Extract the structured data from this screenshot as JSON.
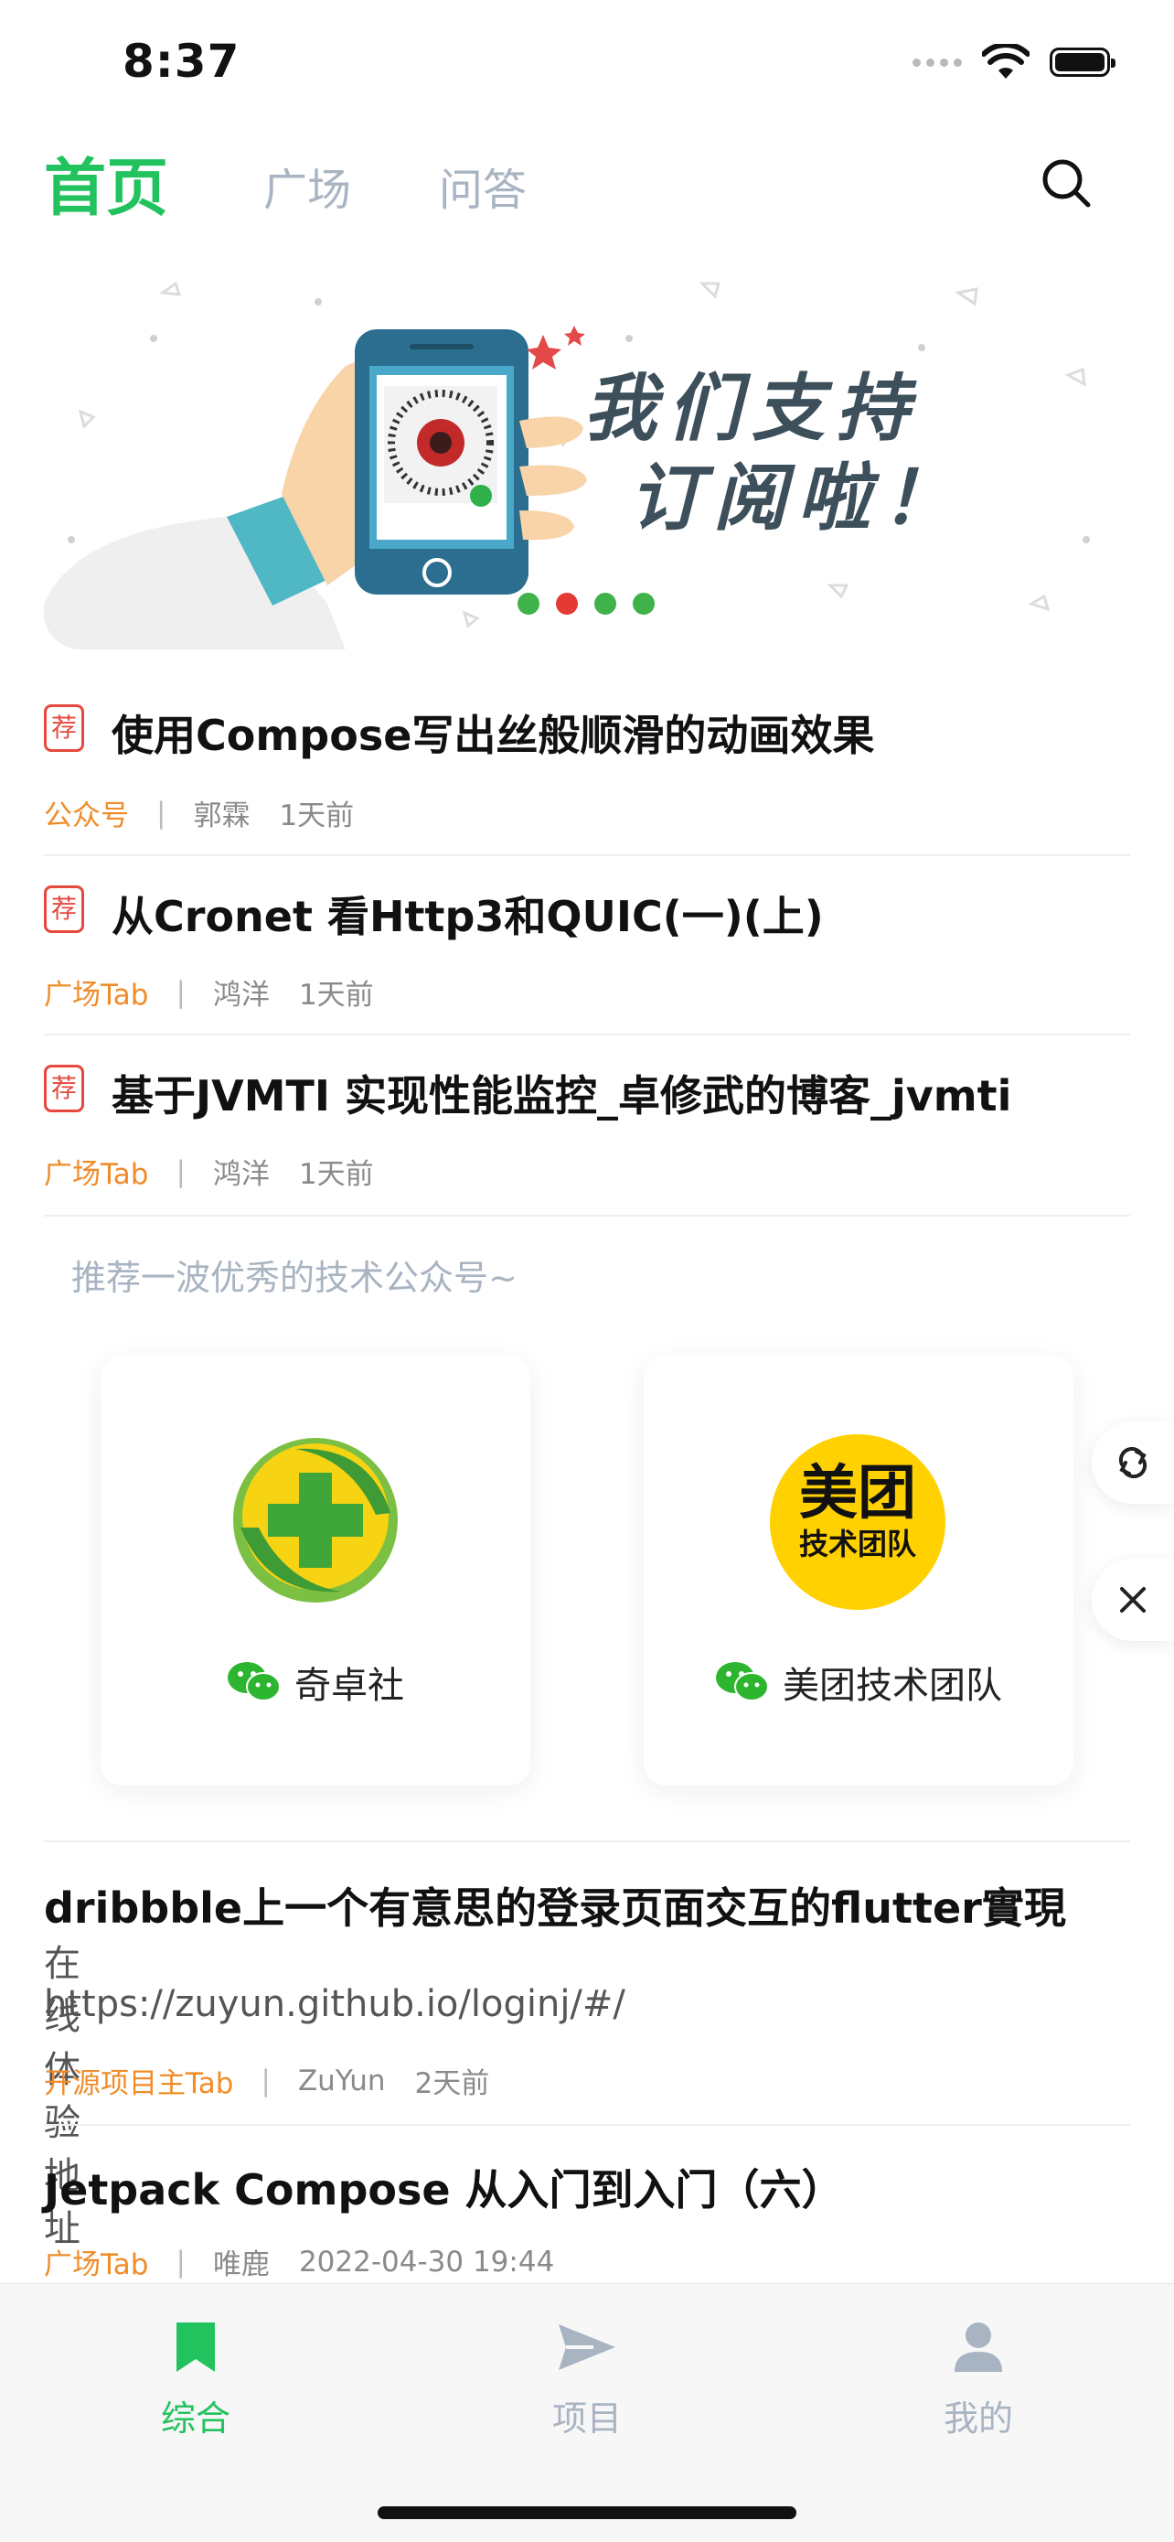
{
  "status_bar": {
    "time": "8:37"
  },
  "header": {
    "tabs": [
      {
        "label": "首页",
        "active": true
      },
      {
        "label": "广场",
        "active": false
      },
      {
        "label": "问答",
        "active": false
      }
    ],
    "icons": {
      "search": "search-icon"
    }
  },
  "banner": {
    "text_line1": "我们支持",
    "text_line2": "订阅啦！",
    "pager_colors": [
      "#3fb24a",
      "#e53935",
      "#3fb24a",
      "#3fb24a"
    ]
  },
  "articles": [
    {
      "tag": "荐",
      "title": "使用Compose写出丝般顺滑的动画效果",
      "chapter": "公众号",
      "sep": "|",
      "author": "郭霖",
      "time": "1天前"
    },
    {
      "tag": "荐",
      "title": "从Cronet 看Http3和QUIC(一)(上)",
      "chapter": "广场Tab",
      "sep": "|",
      "author": "鸿洋",
      "time": "1天前"
    },
    {
      "tag": "荐",
      "title": "基于JVMTI 实现性能监控_卓修武的博客_jvmti",
      "chapter": "广场Tab",
      "sep": "|",
      "author": "鸿洋",
      "time": "1天前"
    }
  ],
  "recommend": {
    "title": "推荐一波优秀的技术公众号~",
    "accounts": [
      {
        "name": "奇卓社",
        "logo": "qizhuo-logo"
      },
      {
        "name": "美团技术团队",
        "logo": "meituan-logo",
        "logo_text1": "美团",
        "logo_text2": "技术团队"
      }
    ],
    "icons": {
      "refresh": "refresh-icon",
      "close": "close-icon",
      "wechat": "wechat-icon"
    }
  },
  "more_articles": [
    {
      "title": "dribbble上一个有意思的登录页面交互的flutter實現",
      "desc_line1": "在线体验地址",
      "desc_line2": "https://zuyun.github.io/loginj/#/",
      "chapter": "开源项目主Tab",
      "sep": "|",
      "author": "ZuYun",
      "time": "2天前"
    },
    {
      "title": "Jetpack Compose 从入门到入门（六）",
      "chapter": "广场Tab",
      "sep": "|",
      "author": "唯鹿",
      "time": "2022-04-30 19:44"
    }
  ],
  "bottom_nav": [
    {
      "label": "综合",
      "icon": "bookmark-icon",
      "active": true
    },
    {
      "label": "项目",
      "icon": "send-icon",
      "active": false
    },
    {
      "label": "我的",
      "icon": "person-icon",
      "active": false
    }
  ],
  "colors": {
    "accent": "#22c35e",
    "chapter": "#f08c2a",
    "tag": "#e5483c",
    "inactive": "#a9b4c2"
  }
}
